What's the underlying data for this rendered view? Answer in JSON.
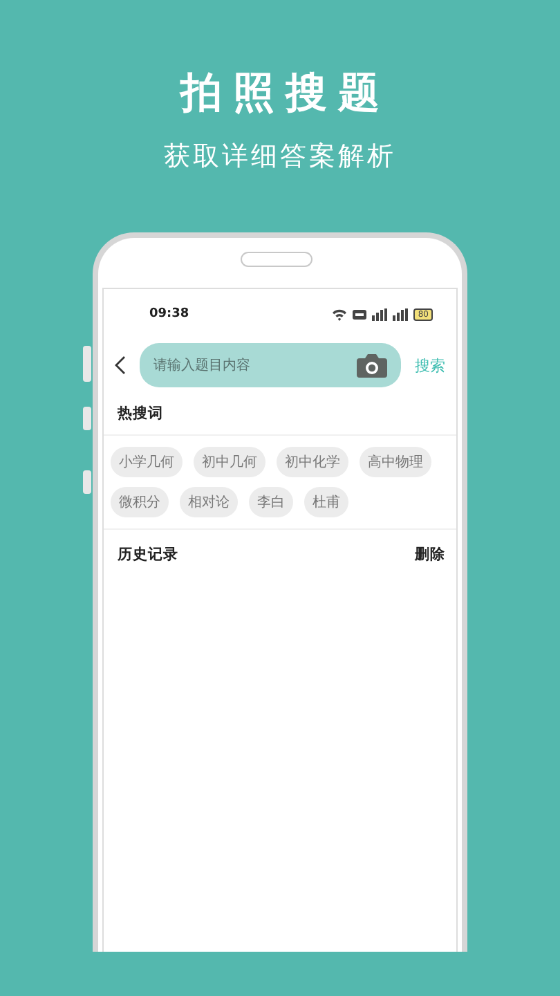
{
  "headline": "拍照搜题",
  "subtitle": "获取详细答案解析",
  "status_bar": {
    "time": "09:38",
    "battery": "80"
  },
  "search": {
    "placeholder": "请输入题目内容",
    "button": "搜索"
  },
  "hot": {
    "title": "热搜词",
    "tags": [
      "小学几何",
      "初中几何",
      "初中化学",
      "高中物理",
      "微积分",
      "相对论",
      "李白",
      "杜甫"
    ]
  },
  "history": {
    "title": "历史记录",
    "action": "删除"
  }
}
